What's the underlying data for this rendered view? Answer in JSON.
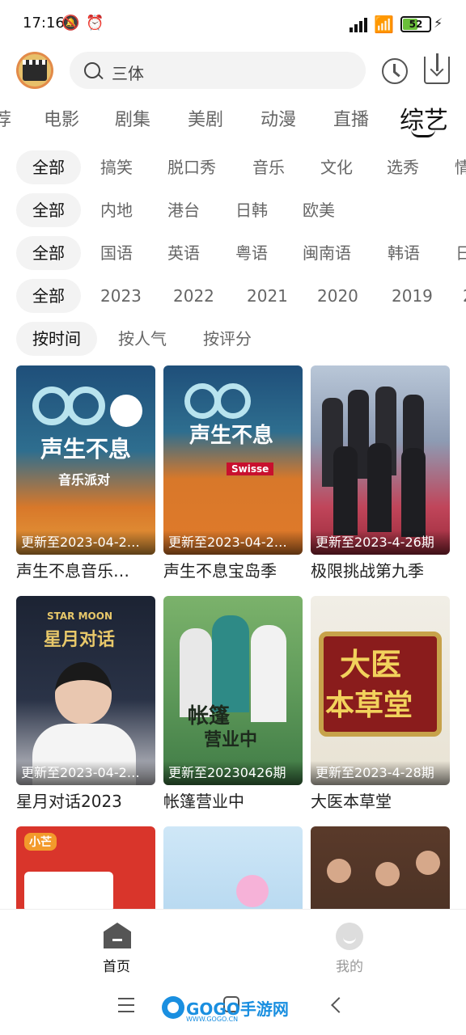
{
  "status_bar": {
    "time": "17:16",
    "battery": "52"
  },
  "header": {
    "search_text": "三体"
  },
  "tabs": [
    {
      "label": "荐"
    },
    {
      "label": "电影"
    },
    {
      "label": "剧集"
    },
    {
      "label": "美剧"
    },
    {
      "label": "动漫"
    },
    {
      "label": "直播"
    },
    {
      "label": "综艺"
    }
  ],
  "filters": {
    "type": [
      "全部",
      "搞笑",
      "脱口秀",
      "音乐",
      "文化",
      "选秀",
      "情"
    ],
    "region": [
      "全部",
      "内地",
      "港台",
      "日韩",
      "欧美"
    ],
    "language": [
      "全部",
      "国语",
      "英语",
      "粤语",
      "闽南语",
      "韩语",
      "日"
    ],
    "year": [
      "全部",
      "2023",
      "2022",
      "2021",
      "2020",
      "2019",
      "2"
    ],
    "sort": [
      "按时间",
      "按人气",
      "按评分"
    ]
  },
  "cards": [
    {
      "title": "声生不息音乐…",
      "update": "更新至2023-04-2…",
      "art": "声生不息",
      "art2": "音乐派对"
    },
    {
      "title": "声生不息宝岛季",
      "update": "更新至2023-04-2…",
      "art": "声生不息",
      "art2": "Swisse"
    },
    {
      "title": "极限挑战第九季",
      "update": "更新至2023-4-26期",
      "art": "",
      "art2": ""
    },
    {
      "title": "星月对话2023",
      "update": "更新至2023-04-2…",
      "art": "星月对话",
      "art2": "STAR MOON"
    },
    {
      "title": "帐篷营业中",
      "update": "更新至20230426期",
      "art": "帐篷",
      "art2": "营业中"
    },
    {
      "title": "大医本草堂",
      "update": "更新至2023-4-28期",
      "art": "大医",
      "art2": "本草堂"
    },
    {
      "title": "",
      "update": "",
      "art": "小芒",
      "art2": ""
    },
    {
      "title": "",
      "update": "",
      "art": "",
      "art2": ""
    },
    {
      "title": "",
      "update": "",
      "art": "",
      "art2": ""
    }
  ],
  "bottom_nav": {
    "home": "首页",
    "me": "我的"
  },
  "watermark": {
    "text": "GOGO手游网",
    "sub": "WWW.GOGO.CN"
  }
}
